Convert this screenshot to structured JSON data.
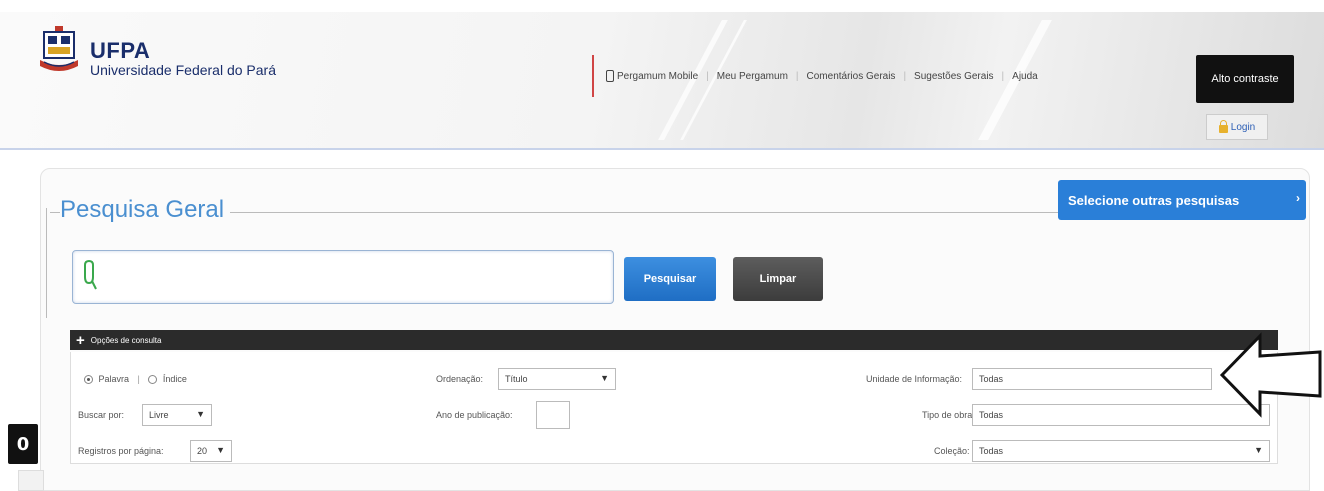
{
  "brand": {
    "title": "UFPA",
    "subtitle": "Universidade Federal do Pará"
  },
  "topnav": {
    "items": [
      "Pergamum Mobile",
      "Meu Pergamum",
      "Comentários Gerais",
      "Sugestões Gerais",
      "Ajuda"
    ]
  },
  "header": {
    "contrast_label": "Alto contraste",
    "login_label": "Login"
  },
  "panel": {
    "title": "Pesquisa Geral",
    "other_search_label": "Selecione outras pesquisas",
    "other_search_icon": "chevron-right-icon"
  },
  "search": {
    "value": "",
    "placeholder": "",
    "search_button": "Pesquisar",
    "clear_button": "Limpar"
  },
  "options": {
    "bar_label": "Opções de consulta",
    "radio_palavra": "Palavra",
    "radio_indice": "Índice",
    "buscar_por_label": "Buscar por:",
    "buscar_por_value": "Livre",
    "registros_label": "Registros por página:",
    "registros_value": "20",
    "ordenacao_label": "Ordenação:",
    "ordenacao_value": "Título",
    "ano_label": "Ano de publicação:",
    "unidade_label": "Unidade de Informação:",
    "unidade_value": "Todas",
    "tipo_obra_label": "Tipo de obra:",
    "tipo_obra_value": "Todas",
    "colecao_label": "Coleção:",
    "colecao_value": "Todas"
  },
  "side": {
    "badge": "0"
  },
  "colors": {
    "accent_blue": "#2a7fd8",
    "brand_navy": "#1a2e6b",
    "title_blue": "#4a8fd0",
    "dark_bar": "#2b2b2b"
  }
}
